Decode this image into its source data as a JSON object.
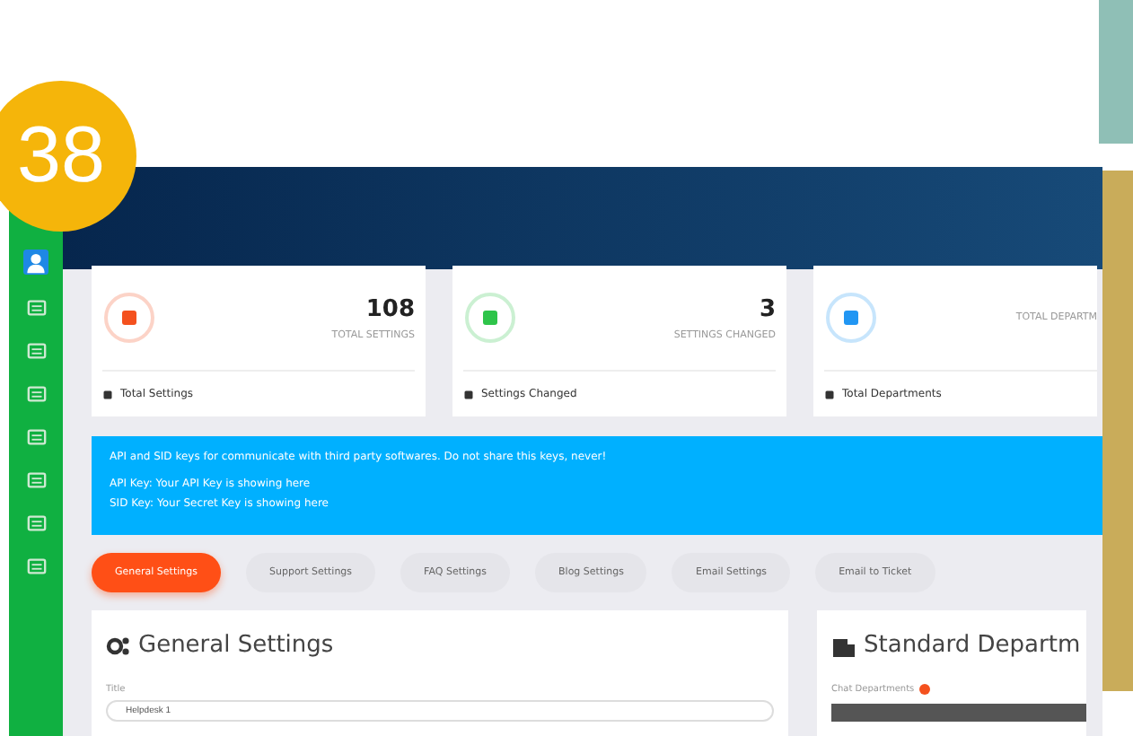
{
  "badge": "38",
  "stats": [
    {
      "value": "108",
      "label": "TOTAL SETTINGS",
      "footer": "Total Settings",
      "color": "#f4511e"
    },
    {
      "value": "3",
      "label": "SETTINGS CHANGED",
      "footer": "Settings Changed",
      "color": "#2ec44a"
    },
    {
      "label": "TOTAL DEPARTM",
      "footer": "Total Departments",
      "color": "#2196f3"
    }
  ],
  "notice": {
    "lines": [
      "API and SID keys for communicate with third party softwares. Do not share this keys, never!",
      "API Key: Your API Key is showing here",
      "SID Key: Your Secret Key is showing here"
    ]
  },
  "tabs": [
    {
      "label": "General Settings",
      "selected": true
    },
    {
      "label": "Support Settings",
      "selected": false
    },
    {
      "label": "FAQ Settings",
      "selected": false
    },
    {
      "label": "Blog Settings",
      "selected": false
    },
    {
      "label": "Email Settings",
      "selected": false
    },
    {
      "label": "Email to Ticket",
      "selected": false
    }
  ],
  "general": {
    "title": "General Settings",
    "field_label": "Title",
    "field_value": "Helpdesk 1"
  },
  "departments": {
    "title": "Standard Departm",
    "field_label": "Chat Departments"
  }
}
